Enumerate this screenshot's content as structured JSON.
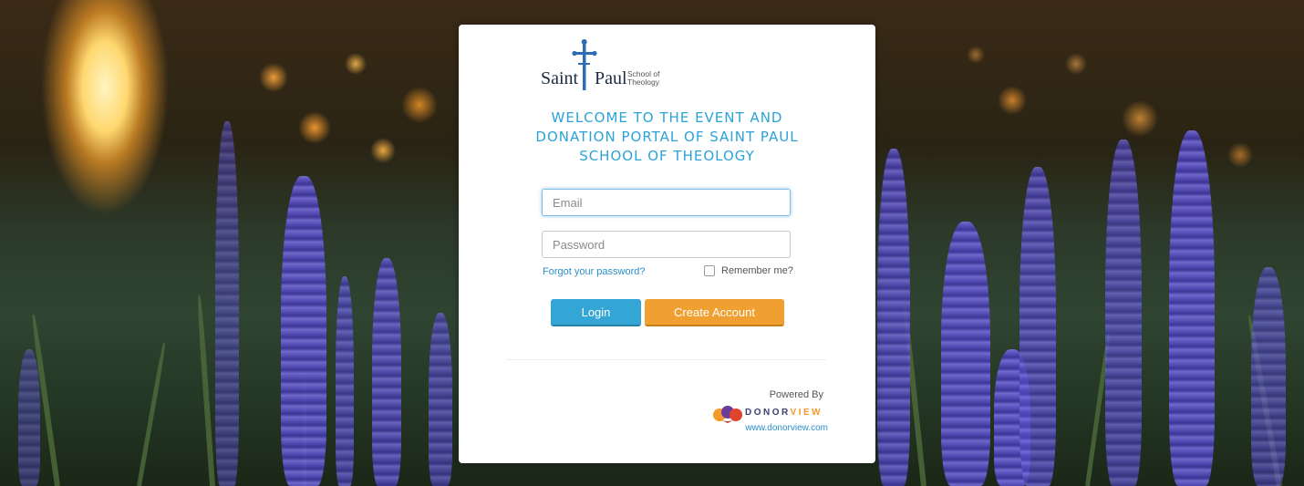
{
  "brand": {
    "logo_saint": "Saint",
    "logo_paul": "Paul",
    "logo_school_line1": "School of",
    "logo_school_line2": "Theology"
  },
  "welcome": {
    "line1": "WELCOME TO THE EVENT AND",
    "line2": "DONATION PORTAL OF SAINT PAUL",
    "line3": "SCHOOL OF THEOLOGY"
  },
  "form": {
    "email_placeholder": "Email",
    "password_placeholder": "Password",
    "forgot_label": "Forgot your password?",
    "remember_label": "Remember me?",
    "login_label": "Login",
    "create_label": "Create Account"
  },
  "footer": {
    "powered_by": "Powered By",
    "vendor_name_part1": "DONOR",
    "vendor_name_part2": "VIEW",
    "vendor_url": "www.donorview.com"
  },
  "colors": {
    "accent_blue": "#2ba3d9",
    "accent_orange": "#f0a030",
    "brand_navy": "#1c2a44"
  }
}
